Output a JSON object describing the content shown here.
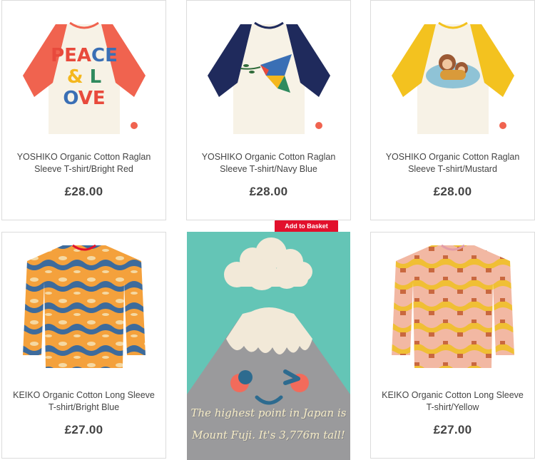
{
  "products": [
    {
      "title_line1": "YOSHIKO Organic Cotton Raglan",
      "title_line2": "Sleeve T-shirt/Bright Red",
      "price": "£28.00",
      "image": "peace-love-raglan-tshirt",
      "colors": {
        "sleeve": "#f0634f",
        "body": "#f7f2e6"
      },
      "print_text": "PEACE & LOVE"
    },
    {
      "title_line1": "YOSHIKO Organic Cotton Raglan",
      "title_line2": "Sleeve T-shirt/Navy Blue",
      "price": "£28.00",
      "image": "bird-raglan-tshirt",
      "colors": {
        "sleeve": "#1f2a5c",
        "body": "#f7f2e6"
      }
    },
    {
      "title_line1": "YOSHIKO Organic Cotton Raglan",
      "title_line2": "Sleeve T-shirt/Mustard",
      "price": "£28.00",
      "image": "monkey-raglan-tshirt",
      "colors": {
        "sleeve": "#f3c21f",
        "body": "#f7f2e6"
      }
    },
    {
      "title_line1": "KEIKO Organic Cotton Long Sleeve",
      "title_line2": "T-shirt/Bright Blue",
      "price": "£27.00",
      "image": "camo-long-sleeve-tshirt-blue",
      "colors": {
        "a": "#f4a13c",
        "b": "#3d6b9c",
        "c": "#f5d9a3"
      }
    },
    {
      "title_line1": "KEIKO Organic Cotton Long Sleeve",
      "title_line2": "T-shirt/Yellow",
      "price": "£27.00",
      "image": "camo-long-sleeve-tshirt-yellow",
      "colors": {
        "a": "#f0bf34",
        "b": "#f2b8a3",
        "c": "#c9683f"
      }
    }
  ],
  "add_to_basket_label": "Add to Basket",
  "promo": {
    "line1": "The highest point in Japan is",
    "line2": "Mount Fuji. It's 3,776m tall!",
    "colors": {
      "bg": "#64c5b6",
      "mountain": "#9a9a9c",
      "snow": "#f2e9d8",
      "cheek": "#f26b5b",
      "eye": "#2d6b8f"
    }
  }
}
